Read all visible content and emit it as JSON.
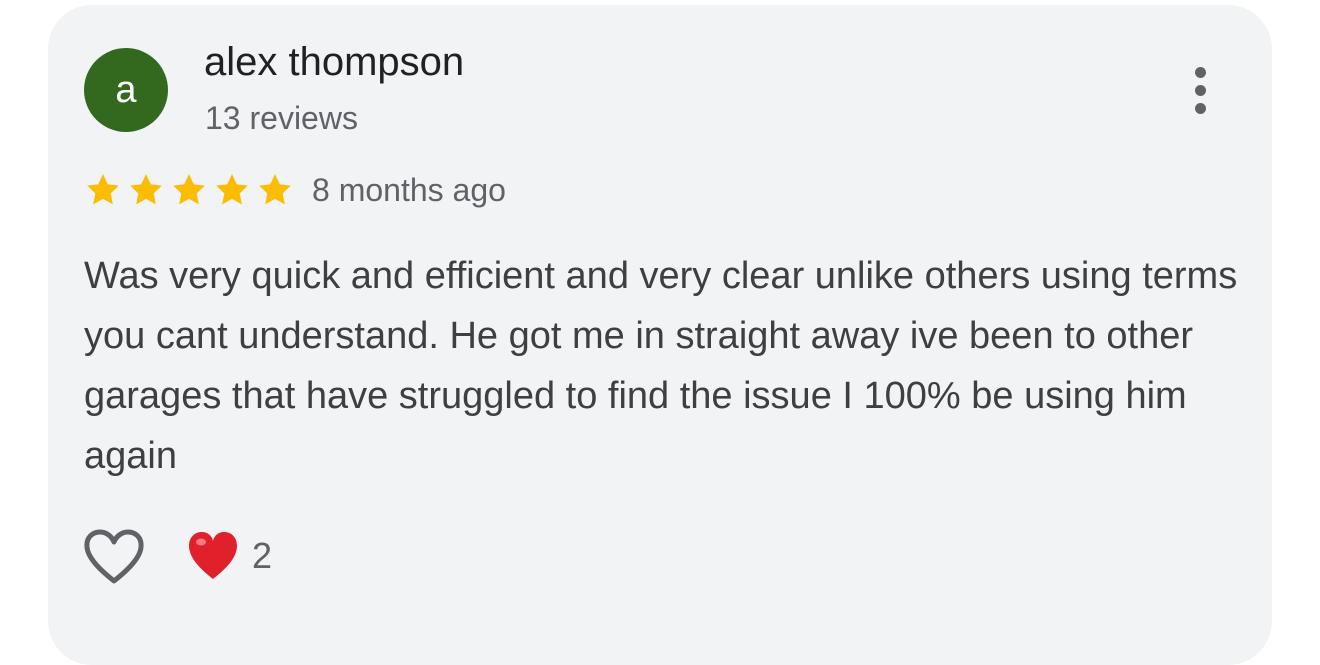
{
  "author": {
    "initial": "a",
    "name": "alex thompson",
    "reviews": "13 reviews",
    "avatar_color": "#33691e"
  },
  "review": {
    "rating": 5,
    "rating_max": 5,
    "star_color": "#fbbc04",
    "time": "8 months ago",
    "text": "Was very quick and efficient and very clear unlike others using terms you cant understand. He got me in straight away ive been to other garages that have struggled to find the issue I 100% be using him again"
  },
  "actions": {
    "more_icon": "more-vert-icon",
    "like_icon": "heart-outline-icon",
    "reaction_icon": "red-heart-icon",
    "reaction_count": "2"
  }
}
